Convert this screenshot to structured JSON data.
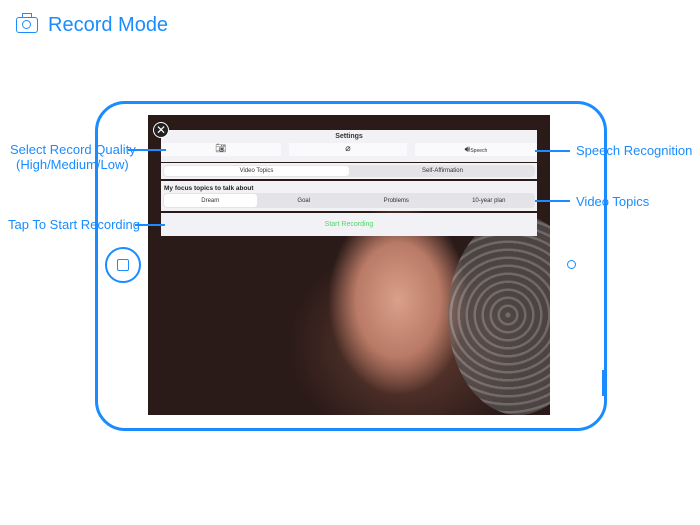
{
  "header": {
    "title": "Record Mode",
    "icon": "camera-icon"
  },
  "annotations": {
    "quality_line1": "Select Record Quality",
    "quality_line2": "(High/Medium/Low)",
    "start": "Tap To Start Recording",
    "speech": "Speech Recognition",
    "topics": "Video Topics"
  },
  "settings": {
    "title": "Settings",
    "speech_label": "Speech",
    "close": "✕"
  },
  "mode_tabs": [
    {
      "label": "Video Topics",
      "selected": true
    },
    {
      "label": "Self-Affirmation",
      "selected": false
    }
  ],
  "focus": {
    "heading": "My focus topics to talk about",
    "options": [
      {
        "label": "Dream",
        "selected": true
      },
      {
        "label": "Goal"
      },
      {
        "label": "Problems"
      },
      {
        "label": "10-year plan"
      }
    ]
  },
  "start_button": "Start Recording",
  "colors": {
    "accent": "#1a8cff",
    "start": "#4cd964"
  }
}
